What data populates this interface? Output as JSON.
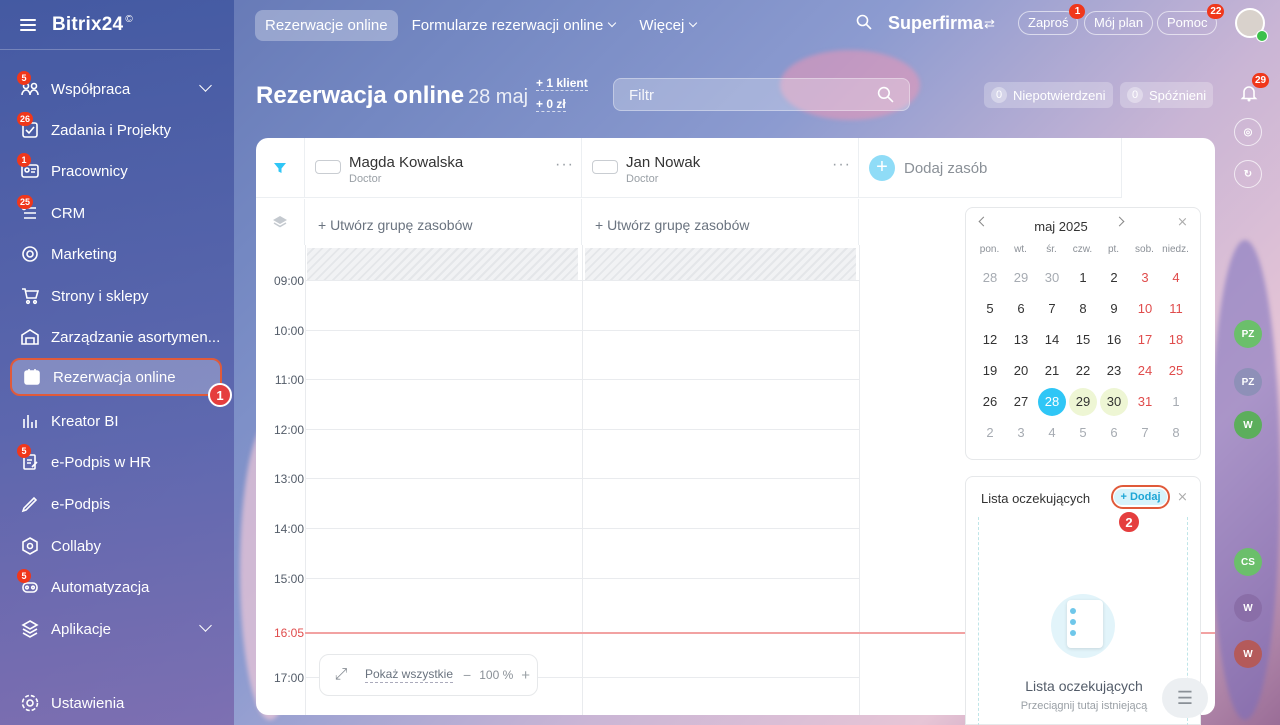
{
  "app": {
    "logo": "Bitrix24",
    "logo_mark": "©"
  },
  "sidebar": {
    "items": [
      {
        "label": "Współpraca",
        "badge": "5",
        "icon": "collab-icon",
        "chevron": true
      },
      {
        "label": "Zadania i Projekty",
        "badge": "26",
        "icon": "tasks-icon"
      },
      {
        "label": "Pracownicy",
        "badge": "1",
        "icon": "employees-icon"
      },
      {
        "label": "CRM",
        "badge": "25",
        "icon": "crm-icon"
      },
      {
        "label": "Marketing",
        "badge": "",
        "icon": "marketing-icon"
      },
      {
        "label": "Strony i sklepy",
        "badge": "",
        "icon": "cart-icon"
      },
      {
        "label": "Zarządzanie asortymen...",
        "badge": "",
        "icon": "warehouse-icon"
      },
      {
        "label": "Rezerwacja online",
        "badge": "",
        "icon": "booking-icon",
        "active": true
      },
      {
        "label": "Kreator BI",
        "badge": "",
        "icon": "bi-icon"
      },
      {
        "label": "e-Podpis w HR",
        "badge": "5",
        "icon": "esign-hr-icon"
      },
      {
        "label": "e-Podpis",
        "badge": "",
        "icon": "esign-icon"
      },
      {
        "label": "Collaby",
        "badge": "",
        "icon": "collaby-icon"
      },
      {
        "label": "Automatyzacja",
        "badge": "5",
        "icon": "automation-icon"
      },
      {
        "label": "Aplikacje",
        "badge": "",
        "icon": "apps-icon",
        "chevron": true
      }
    ],
    "settings_label": "Ustawienia",
    "step1": "1"
  },
  "topbar": {
    "tabs": [
      "Rezerwacje online",
      "Formularze rezerwacji online",
      "Więcej"
    ],
    "company": "Superfirma",
    "invite": "Zaproś",
    "invite_badge": "1",
    "myplan": "Mój plan",
    "help": "Pomoc",
    "help_badge": "22"
  },
  "page": {
    "title": "Rezerwacja online",
    "date": "28 maj",
    "stat_clients": "+ 1 klient",
    "stat_money": "+ 0 zł",
    "filter_placeholder": "Filtr",
    "unconfirmed_count": "0",
    "unconfirmed": "Niepotwierdzeni",
    "late_count": "0",
    "late": "Spóźnieni"
  },
  "resources": [
    {
      "name": "Magda Kowalska",
      "role": "Doctor"
    },
    {
      "name": "Jan Nowak",
      "role": "Doctor"
    }
  ],
  "add_resource": "Dodaj zasób",
  "create_group": "+ Utwórz grupę zasobów",
  "times": [
    "09:00",
    "10:00",
    "11:00",
    "12:00",
    "13:00",
    "14:00",
    "15:00",
    "17:00"
  ],
  "now_time": "16:05",
  "bottom": {
    "show_all": "Pokaż wszystkie",
    "zoom": "100 %",
    "minus": "−",
    "plus": "+"
  },
  "calendar": {
    "title": "maj 2025",
    "weekdays": [
      "pon.",
      "wt.",
      "śr.",
      "czw.",
      "pt.",
      "sob.",
      "niedz."
    ],
    "weeks": [
      [
        "28",
        "29",
        "30",
        "1",
        "2",
        "3",
        "4"
      ],
      [
        "5",
        "6",
        "7",
        "8",
        "9",
        "10",
        "11"
      ],
      [
        "12",
        "13",
        "14",
        "15",
        "16",
        "17",
        "18"
      ],
      [
        "19",
        "20",
        "21",
        "22",
        "23",
        "24",
        "25"
      ],
      [
        "26",
        "27",
        "28",
        "29",
        "30",
        "31",
        "1"
      ],
      [
        "2",
        "3",
        "4",
        "5",
        "6",
        "7",
        "8"
      ]
    ],
    "selected": "28",
    "highlighted": [
      "29",
      "30"
    ]
  },
  "waiting": {
    "title": "Lista oczekujących",
    "add": "+ Dodaj",
    "empty_title": "Lista oczekujących",
    "empty_text": "Przeciągnij tutaj istniejącą",
    "step2": "2"
  },
  "rail": {
    "notif_badge": "29",
    "avatars": [
      "PZ",
      "PZ",
      "W",
      "CS",
      "W",
      "W"
    ]
  },
  "colors": {
    "accent": "#2fc6f6",
    "red": "#e53e3e",
    "now_line": "#f2a2a2"
  }
}
